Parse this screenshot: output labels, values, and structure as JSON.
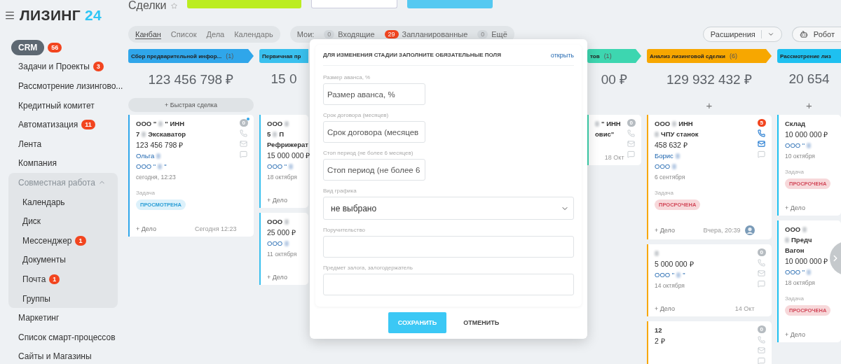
{
  "logo": {
    "text": "ЛИЗИНГ",
    "accent": "24"
  },
  "sidebar": {
    "items": [
      {
        "kind": "item",
        "label": "CRM",
        "badge": "56",
        "selected": true
      },
      {
        "kind": "item",
        "label": "Задачи и Проекты",
        "badge": "3",
        "selected": false
      },
      {
        "kind": "item",
        "label": "Рассмотрение лизингово...",
        "selected": false
      },
      {
        "kind": "item",
        "label": "Кредитный комитет",
        "selected": false
      },
      {
        "kind": "item",
        "label": "Автоматизация",
        "badge": "11",
        "selected": false
      },
      {
        "kind": "item",
        "label": "Лента",
        "selected": false
      },
      {
        "kind": "item",
        "label": "Компания",
        "selected": false
      },
      {
        "kind": "group",
        "label": "Совместная работа",
        "expanded": true,
        "children": [
          {
            "label": "Календарь"
          },
          {
            "label": "Диск"
          },
          {
            "label": "Мессенджер",
            "badge": "1"
          },
          {
            "label": "Документы"
          },
          {
            "label": "Почта",
            "badge": "1"
          },
          {
            "label": "Группы"
          }
        ]
      },
      {
        "kind": "item",
        "label": "Маркетинг",
        "selected": false
      },
      {
        "kind": "item",
        "label": "Список смарт-процессов",
        "selected": false
      },
      {
        "kind": "item",
        "label": "Сайты и Магазины",
        "selected": false
      }
    ]
  },
  "page_title": "Сделки",
  "view_tabs": [
    {
      "label": "Канбан",
      "selected": true
    },
    {
      "label": "Список",
      "selected": false
    },
    {
      "label": "Дела",
      "selected": false
    },
    {
      "label": "Календарь",
      "selected": false
    }
  ],
  "counters": {
    "label": "Мои:",
    "items": [
      {
        "count": "0",
        "label": "Входящие",
        "alert": false
      },
      {
        "count": "29",
        "label": "Запланированные",
        "alert": true
      },
      {
        "count": "0",
        "label": "Ещё",
        "alert": false
      }
    ]
  },
  "toolbar_right": [
    {
      "kind": "split",
      "label": "Расширения"
    },
    {
      "kind": "robot",
      "label": "Робот"
    }
  ],
  "columns": [
    {
      "title": "Сбор предварительной инфор...",
      "count": "(1)",
      "color": "#2fa6ea",
      "sum": "123 456 798 ₽",
      "add": {
        "kind": "quick",
        "label": "+ Быстрая сделка"
      },
      "cards": [
        {
          "counter": "0",
          "counter_alert": false,
          "counter_dot": true,
          "icons": true,
          "icons_active": false,
          "lines": [
            {
              "kind": "title",
              "parts": [
                "ООО \"",
                "\" ИНН"
              ]
            },
            {
              "kind": "title",
              "parts": [
                "7",
                "Экскаватор"
              ]
            },
            {
              "kind": "amount",
              "parts": [
                "123 456 798 ₽"
              ]
            },
            {
              "kind": "link",
              "parts": [
                "Ольга"
              ],
              "redacted_after": true
            },
            {
              "kind": "link",
              "parts": [
                "ООО \"",
                "\""
              ]
            },
            {
              "kind": "date",
              "parts": [
                "сегодня, 12:23"
              ]
            }
          ],
          "task": {
            "label": "Задача",
            "status": "ПРОСМОТРЕНА",
            "overdue": false
          },
          "footer": {
            "add": "+ Дело",
            "time": "Сегодня 12:23"
          }
        }
      ]
    },
    {
      "title": "Первичная пр",
      "color": "#39c0ee",
      "sum": "15 0",
      "cards": [
        {
          "lines": [
            {
              "kind": "title",
              "parts": [
                "ООО"
              ],
              "redacted_after": true
            },
            {
              "kind": "title",
              "parts": [
                "5",
                "П"
              ]
            },
            {
              "kind": "title",
              "parts": [
                "Рефрижерат"
              ]
            },
            {
              "kind": "amount",
              "parts": [
                "15 000 000 ₽"
              ]
            },
            {
              "kind": "link",
              "parts": [
                "ООО \""
              ],
              "redacted_after": true
            },
            {
              "kind": "date",
              "parts": [
                "18 октября"
              ]
            }
          ],
          "footer": {
            "add": "+ Дело"
          }
        },
        {
          "lines": [
            {
              "kind": "title",
              "parts": [
                "ООО"
              ],
              "redacted_after": true
            },
            {
              "kind": "amount",
              "parts": [
                "25 000 ₽"
              ]
            },
            {
              "kind": "link",
              "parts": [
                "ООО"
              ],
              "redacted_after": true
            },
            {
              "kind": "date",
              "parts": [
                "11 октября"
              ]
            }
          ],
          "footer": {
            "add": "+ Дело"
          }
        }
      ]
    },
    {
      "title": "тов",
      "count": "(1)",
      "color": "#3dd6b0",
      "sum": "00 ₽",
      "cards": [
        {
          "counter": "0",
          "counter_alert": false,
          "counter_dot": false,
          "icons": true,
          "icons_active": false,
          "lines": [
            {
              "kind": "title",
              "parts": [
                "\" ИНН"
              ],
              "redacted_before": true
            },
            {
              "kind": "title",
              "parts": [
                "овис\""
              ]
            }
          ],
          "footer": {
            "time": "18 Окт"
          }
        }
      ]
    },
    {
      "title": "Анализ лизинговой сделки",
      "count": "(6)",
      "color": "#f7a700",
      "sum": "129 932 432 ₽",
      "add": {
        "kind": "plus",
        "label": "+"
      },
      "cards": [
        {
          "counter": "5",
          "counter_alert": true,
          "counter_dot": false,
          "icons": true,
          "icons_active": true,
          "lines": [
            {
              "kind": "title",
              "parts": [
                "ООО",
                "ИНН"
              ]
            },
            {
              "kind": "title",
              "parts": [
                "ЧПУ станок"
              ],
              "redacted_before": true
            },
            {
              "kind": "amount",
              "parts": [
                "458 632 ₽"
              ]
            },
            {
              "kind": "link",
              "parts": [
                "Борис"
              ],
              "redacted_after": true
            },
            {
              "kind": "link",
              "parts": [
                "ООО"
              ],
              "redacted_after": true
            },
            {
              "kind": "date",
              "parts": [
                "6 сентября"
              ]
            }
          ],
          "task": {
            "label": "Задача",
            "status": "ПРОСРОЧЕНА",
            "overdue": true
          },
          "footer": {
            "add": "+ Дело",
            "time": "Вчера, 20:39",
            "avatar": true
          }
        },
        {
          "counter": "0",
          "counter_alert": false,
          "counter_dot": false,
          "icons": true,
          "icons_active": false,
          "lines": [
            {
              "kind": "title",
              "redacted": true
            },
            {
              "kind": "amount",
              "parts": [
                "5 000 000 ₽"
              ]
            },
            {
              "kind": "link",
              "parts": [
                "ООО \"",
                "\""
              ]
            },
            {
              "kind": "date",
              "parts": [
                "14 октября"
              ]
            }
          ],
          "footer": {
            "add": "+ Дело",
            "time": "14 Окт"
          }
        },
        {
          "counter": "0",
          "counter_alert": false,
          "counter_dot": false,
          "icons": true,
          "icons_active": false,
          "lines": [
            {
              "kind": "title",
              "parts": [
                "12"
              ]
            },
            {
              "kind": "amount",
              "parts": [
                "2 ₽"
              ]
            }
          ]
        }
      ]
    },
    {
      "title": "Рассмотрение лиз",
      "color": "#1ec0f0",
      "sum": "20 654",
      "add": {
        "kind": "plus",
        "label": "+"
      },
      "cards": [
        {
          "lines": [
            {
              "kind": "title",
              "parts": [
                "Склад"
              ]
            },
            {
              "kind": "amount",
              "parts": [
                "10 000 000 ₽"
              ]
            },
            {
              "kind": "link",
              "parts": [
                "ООО \""
              ],
              "redacted_after": true
            },
            {
              "kind": "date",
              "parts": [
                "10 октября"
              ]
            }
          ],
          "task": {
            "label": "Задача",
            "status": "ПРОСРОЧЕНА",
            "overdue": true
          },
          "footer": {
            "add": "+ Дело"
          }
        },
        {
          "lines": [
            {
              "kind": "title",
              "parts": [
                "ООО"
              ],
              "redacted_after": true
            },
            {
              "kind": "title",
              "parts": [
                "Предч"
              ],
              "redacted_before": true
            },
            {
              "kind": "title",
              "parts": [
                "Вагон"
              ]
            },
            {
              "kind": "amount",
              "parts": [
                "10 000 000 ₽"
              ]
            },
            {
              "kind": "link",
              "parts": [
                "ООО \""
              ],
              "redacted_after": true
            },
            {
              "kind": "date",
              "parts": [
                "18 октября"
              ]
            }
          ],
          "task": {
            "label": "Задача",
            "status": "ПРОСРОЧЕНА",
            "overdue": true
          },
          "footer": {
            "add": "+ Дело"
          }
        }
      ]
    }
  ],
  "dialog": {
    "title": "ДЛЯ ИЗМЕНЕНИЯ СТАДИИ ЗАПОЛНИТЕ ОБЯЗАТЕЛЬНЫЕ ПОЛЯ",
    "link": "открыть",
    "fields": [
      {
        "kind": "short_input",
        "label": "Размер аванса, %",
        "placeholder": "Размер аванса, %"
      },
      {
        "kind": "short_input",
        "label": "Срок договора (месяцев)",
        "placeholder": "Срок договора (месяцев"
      },
      {
        "kind": "short_input",
        "label": "Стоп период (не более 6 месяцев)",
        "placeholder": "Стоп период (не более 6"
      },
      {
        "kind": "select",
        "label": "Вид графика",
        "value": "не выбрано"
      },
      {
        "kind": "input",
        "label": "Поручительство"
      },
      {
        "kind": "input",
        "label": "Предмет залога, залогодержатель"
      }
    ],
    "buttons": [
      {
        "kind": "primary",
        "label": "СОХРАНИТЬ"
      },
      {
        "kind": "plain",
        "label": "ОТМЕНИТЬ"
      }
    ]
  }
}
